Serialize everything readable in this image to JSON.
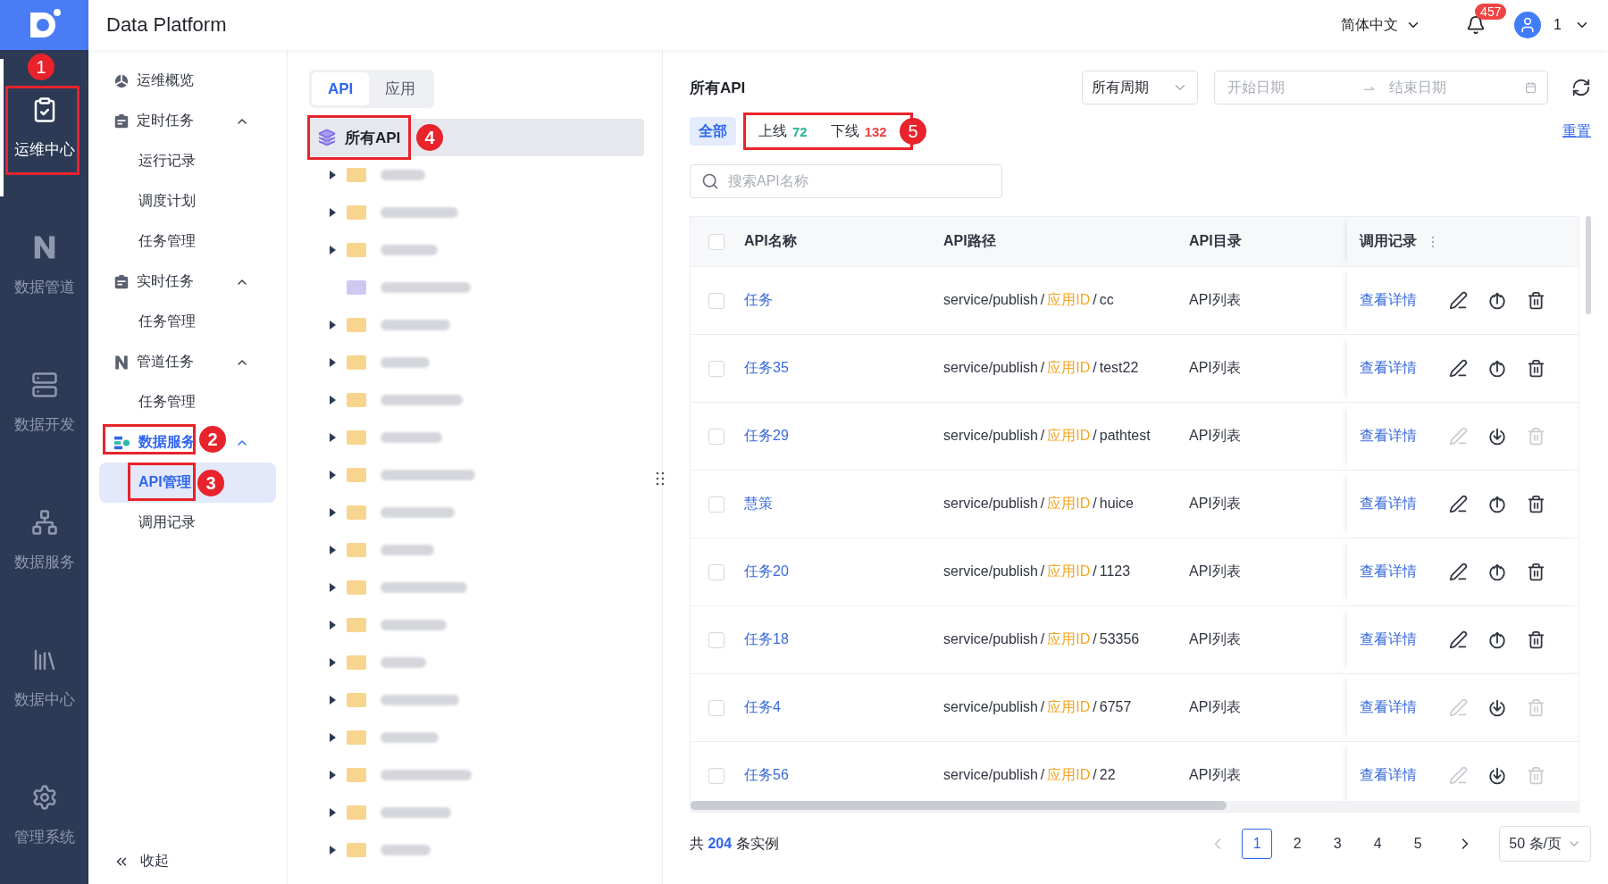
{
  "app": {
    "title": "Data Platform"
  },
  "rail": {
    "items": [
      {
        "label": "运维中心",
        "selected": true,
        "callout": "1"
      },
      {
        "label": "数据管道",
        "selected": false
      },
      {
        "label": "数据开发",
        "selected": false
      },
      {
        "label": "数据服务",
        "selected": false
      },
      {
        "label": "数据中心",
        "selected": false
      },
      {
        "label": "管理系统",
        "selected": false
      }
    ]
  },
  "header": {
    "language": "简体中文",
    "notifications": "457",
    "user": "1"
  },
  "nav": {
    "items": [
      {
        "label": "运维概览"
      },
      {
        "label": "定时任务",
        "expanded": true,
        "children": [
          {
            "label": "运行记录",
            "selected": false
          },
          {
            "label": "调度计划",
            "selected": false
          },
          {
            "label": "任务管理",
            "selected": false
          }
        ]
      },
      {
        "label": "实时任务",
        "expanded": true,
        "children": [
          {
            "label": "任务管理",
            "selected": false
          }
        ]
      },
      {
        "label": "管道任务",
        "expanded": true,
        "children": [
          {
            "label": "任务管理",
            "selected": false
          }
        ]
      },
      {
        "label": "数据服务",
        "expanded": true,
        "callout": "2",
        "children": [
          {
            "label": "API管理",
            "selected": true,
            "callout": "3"
          },
          {
            "label": "调用记录",
            "selected": false
          }
        ]
      }
    ],
    "collapse": "收起"
  },
  "tree": {
    "tabs": [
      {
        "label": "API",
        "selected": true
      },
      {
        "label": "应用",
        "selected": false
      }
    ],
    "root": {
      "label": "所有API",
      "selected": true,
      "callout": "4"
    },
    "rows": [
      {
        "expandable": true,
        "color": "#f8d58e"
      },
      {
        "expandable": true,
        "color": "#f8d58e"
      },
      {
        "expandable": true,
        "color": "#f8d58e"
      },
      {
        "expandable": false,
        "color": "#cfc8f3"
      },
      {
        "expandable": true,
        "color": "#f8d58e"
      },
      {
        "expandable": true,
        "color": "#f8d58e"
      },
      {
        "expandable": true,
        "color": "#f8d58e"
      },
      {
        "expandable": true,
        "color": "#f8d58e"
      },
      {
        "expandable": true,
        "color": "#f8d58e"
      },
      {
        "expandable": true,
        "color": "#f8d58e"
      },
      {
        "expandable": true,
        "color": "#f8d58e"
      },
      {
        "expandable": true,
        "color": "#f8d58e"
      },
      {
        "expandable": true,
        "color": "#f8d58e"
      },
      {
        "expandable": true,
        "color": "#f8d58e"
      },
      {
        "expandable": true,
        "color": "#f8d58e"
      },
      {
        "expandable": true,
        "color": "#f8d58e"
      },
      {
        "expandable": true,
        "color": "#f8d58e"
      },
      {
        "expandable": true,
        "color": "#f8d58e"
      },
      {
        "expandable": true,
        "color": "#f8d58e"
      }
    ]
  },
  "main": {
    "title": "所有API",
    "period": "所有周期",
    "start_placeholder": "开始日期",
    "end_placeholder": "结束日期",
    "filters": [
      {
        "label": "全部",
        "selected": true
      },
      {
        "label": "上线",
        "count": "72",
        "kind": "online",
        "selected": false
      },
      {
        "label": "下线",
        "count": "132",
        "kind": "offline",
        "selected": false
      }
    ],
    "filters_callout": "5",
    "reset": "重置",
    "search_placeholder": "搜索API名称"
  },
  "table": {
    "all_checked": false,
    "columns": [
      "API名称",
      "API路径",
      "API目录",
      "调用记录"
    ],
    "rows": [
      {
        "checked": false,
        "name": "任务",
        "path": {
          "base": "service/publish",
          "sep": "/",
          "var": "应用ID",
          "name": "cc"
        },
        "directory": "API列表",
        "action": "查看详情",
        "online": false
      },
      {
        "checked": false,
        "name": "任务35",
        "path": {
          "base": "service/publish",
          "sep": "/",
          "var": "应用ID",
          "name": "test22"
        },
        "directory": "API列表",
        "action": "查看详情",
        "online": false
      },
      {
        "checked": false,
        "name": "任务29",
        "path": {
          "base": "service/publish",
          "sep": "/",
          "var": "应用ID",
          "name": "pathtest"
        },
        "directory": "API列表",
        "action": "查看详情",
        "online": true
      },
      {
        "checked": false,
        "name": "慧策",
        "path": {
          "base": "service/publish",
          "sep": "/",
          "var": "应用ID",
          "name": "huice"
        },
        "directory": "API列表",
        "action": "查看详情",
        "online": false
      },
      {
        "checked": false,
        "name": "任务20",
        "path": {
          "base": "service/publish",
          "sep": "/",
          "var": "应用ID",
          "name": "1123"
        },
        "directory": "API列表",
        "action": "查看详情",
        "online": false
      },
      {
        "checked": false,
        "name": "任务18",
        "path": {
          "base": "service/publish",
          "sep": "/",
          "var": "应用ID",
          "name": "53356"
        },
        "directory": "API列表",
        "action": "查看详情",
        "online": false
      },
      {
        "checked": false,
        "name": "任务4",
        "path": {
          "base": "service/publish",
          "sep": "/",
          "var": "应用ID",
          "name": "6757"
        },
        "directory": "API列表",
        "action": "查看详情",
        "online": true
      },
      {
        "checked": false,
        "name": "任务56",
        "path": {
          "base": "service/publish",
          "sep": "/",
          "var": "应用ID",
          "name": "22"
        },
        "directory": "API列表",
        "action": "查看详情",
        "online": true
      }
    ]
  },
  "pagination": {
    "total": "共 **204** 条实例",
    "pages": [
      {
        "label": "1",
        "selected": true
      },
      {
        "label": "2",
        "selected": false
      },
      {
        "label": "3",
        "selected": false
      },
      {
        "label": "4",
        "selected": false
      },
      {
        "label": "5",
        "selected": false
      }
    ],
    "page_size": "50 条/页"
  }
}
